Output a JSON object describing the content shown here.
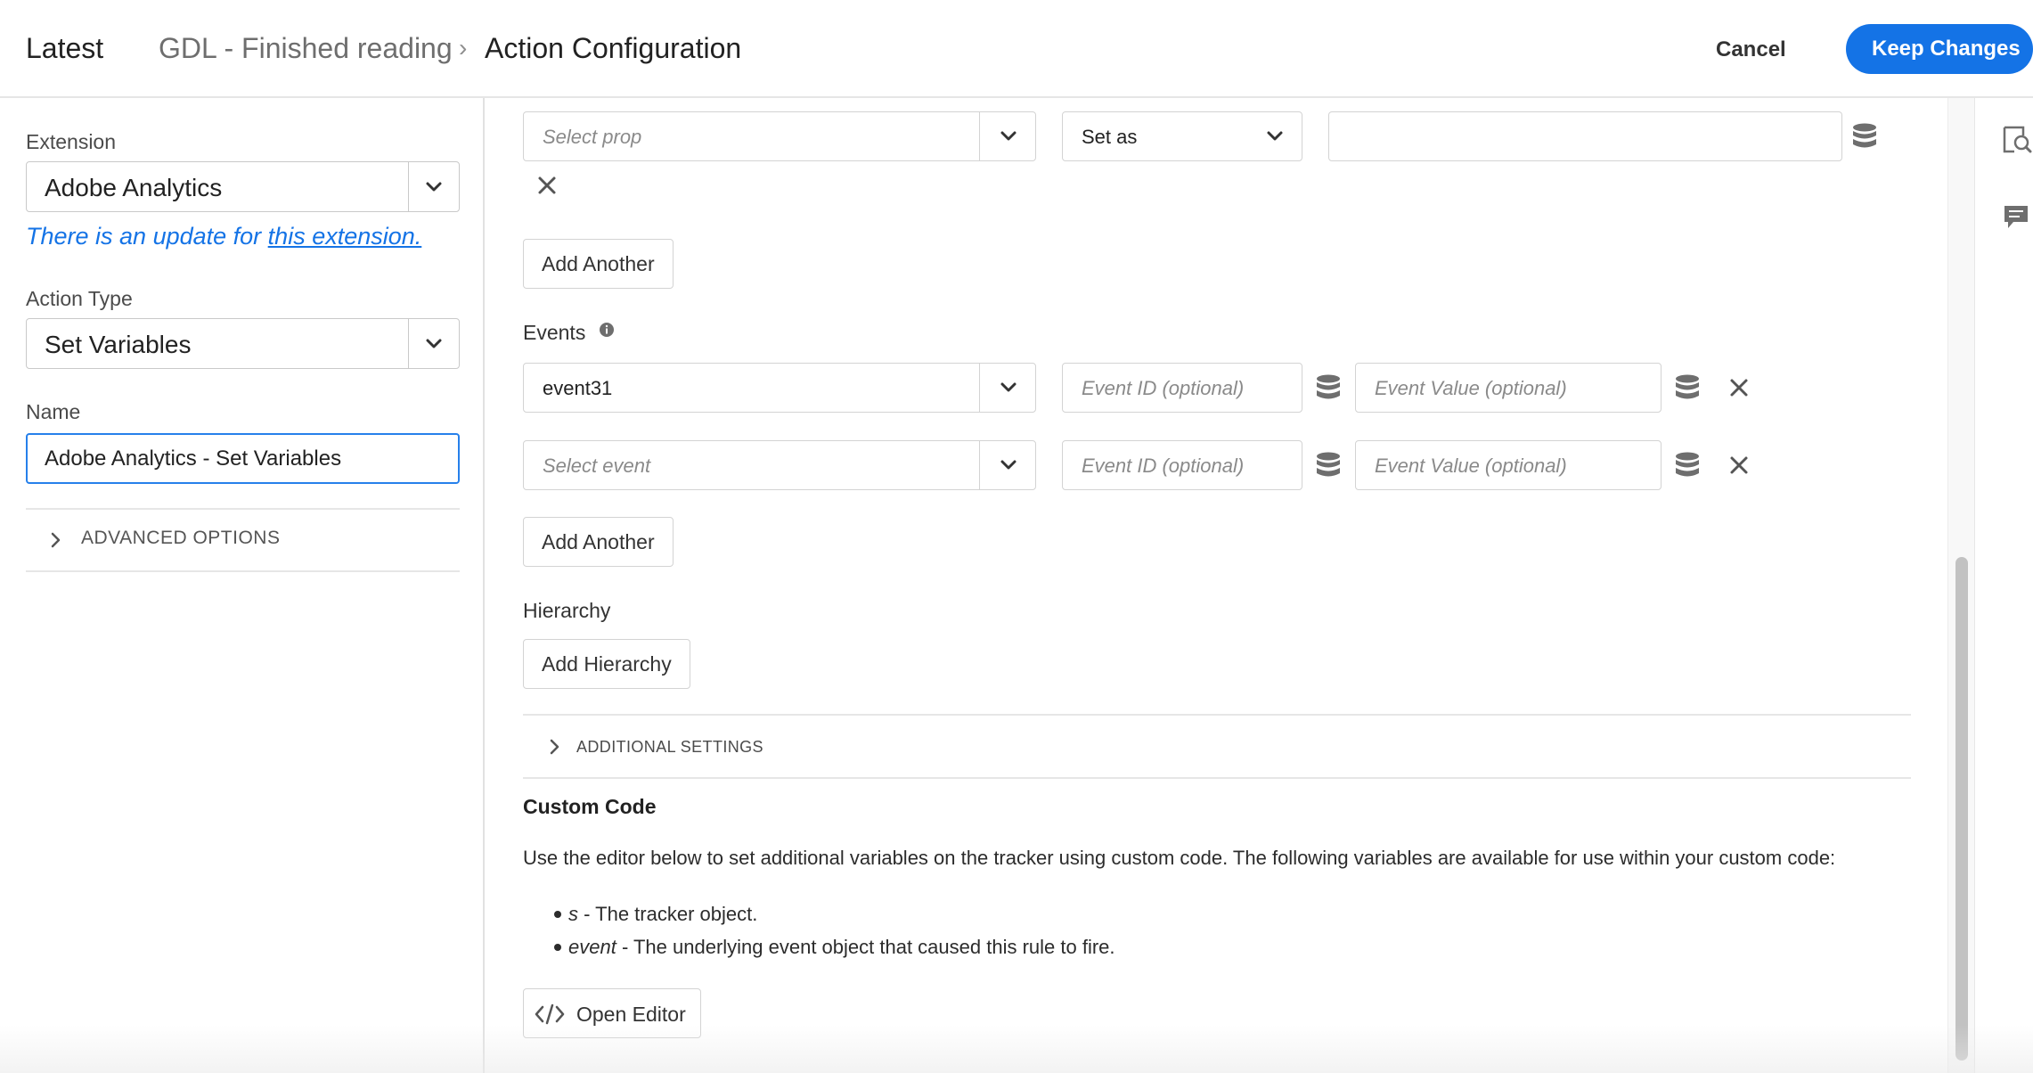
{
  "header": {
    "env": "Latest",
    "breadcrumb_rule": "GDL - Finished reading",
    "separator": "›",
    "title": "Action Configuration",
    "cancel_label": "Cancel",
    "keep_label": "Keep Changes"
  },
  "left": {
    "extension_label": "Extension",
    "extension_value": "Adobe Analytics",
    "update_text": "There is an update for ",
    "update_link": "this extension.",
    "action_type_label": "Action Type",
    "action_type_value": "Set Variables",
    "name_label": "Name",
    "name_value": "Adobe Analytics - Set Variables",
    "advanced_label": "ADVANCED OPTIONS"
  },
  "main": {
    "props_row": {
      "select_placeholder": "Select prop",
      "mode_value": "Set as",
      "value_input": ""
    },
    "add_another_label": "Add Another",
    "events_label": "Events",
    "events": [
      {
        "event": "event31",
        "is_placeholder": false,
        "id_placeholder": "Event ID (optional)",
        "value_placeholder": "Event Value (optional)"
      },
      {
        "event": "Select event",
        "is_placeholder": true,
        "id_placeholder": "Event ID (optional)",
        "value_placeholder": "Event Value (optional)"
      }
    ],
    "hierarchy_label": "Hierarchy",
    "add_hierarchy_label": "Add Hierarchy",
    "additional_settings_label": "ADDITIONAL SETTINGS",
    "custom_code_label": "Custom Code",
    "custom_code_desc": "Use the editor below to set additional variables on the tracker using custom code. The following variables are available for use within your custom code:",
    "bullets": [
      {
        "term": "s",
        "desc": " - The tracker object."
      },
      {
        "term": "event",
        "desc": " - The underlying event object that caused this rule to fire."
      }
    ],
    "open_editor_label": "Open Editor"
  },
  "colors": {
    "accent": "#1473e6",
    "focus_border": "#2680eb",
    "icon_gray": "#6e6e6e"
  },
  "icons": [
    "chevron-down-icon",
    "data-element-icon",
    "close-icon",
    "chevron-right-icon",
    "code-icon",
    "preview-icon",
    "comment-icon",
    "info-icon"
  ]
}
